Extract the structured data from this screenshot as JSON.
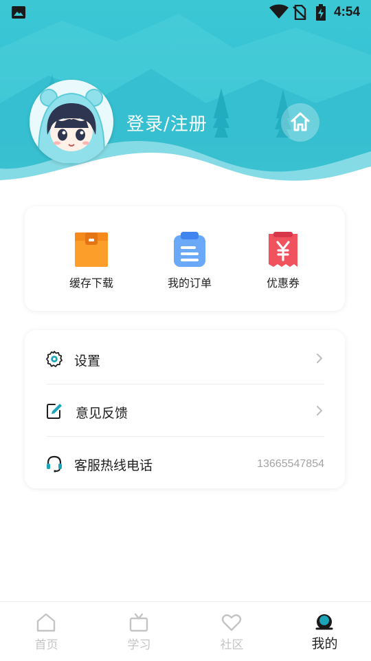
{
  "status_bar": {
    "time": "4:54",
    "icons": [
      "gallery-icon",
      "wifi-icon",
      "no-sim-icon",
      "battery-charging-icon"
    ]
  },
  "profile": {
    "login_label": "登录/注册",
    "avatar": "avatar-icon",
    "home_button_icon": "home-icon"
  },
  "quick_actions": [
    {
      "label": "缓存下载",
      "icon": "download-box-icon",
      "color": "#fb9f2a"
    },
    {
      "label": "我的订单",
      "icon": "clipboard-icon",
      "color": "#5b9cf5"
    },
    {
      "label": "优惠券",
      "icon": "coupon-icon",
      "color": "#f0525e"
    }
  ],
  "menu": [
    {
      "label": "设置",
      "icon": "gear-icon"
    },
    {
      "label": "意见反馈",
      "icon": "edit-icon"
    },
    {
      "label": "客服热线电话",
      "icon": "headset-icon",
      "value": "13665547854"
    }
  ],
  "bottom_nav": [
    {
      "label": "首页",
      "icon": "home-outline-icon",
      "active": false
    },
    {
      "label": "学习",
      "icon": "tv-icon",
      "active": false
    },
    {
      "label": "社区",
      "icon": "heart-icon",
      "active": false
    },
    {
      "label": "我的",
      "icon": "profile-icon",
      "active": true
    }
  ],
  "colors": {
    "banner": "#36c3d3",
    "accent_teal": "#1aa5b8",
    "nav_inactive": "#c4c4c4",
    "nav_active": "#222222"
  }
}
